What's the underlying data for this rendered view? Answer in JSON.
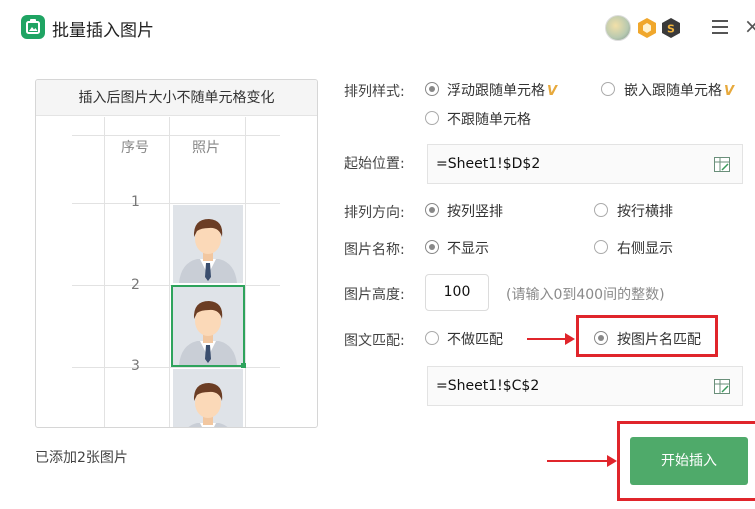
{
  "app": {
    "title": "批量插入图片",
    "accent_color": "#1fa463",
    "icons": [
      "app-icon",
      "avatar",
      "vip-badge-icon",
      "s-badge-icon",
      "menu-icon",
      "close-icon"
    ]
  },
  "preview": {
    "header": "插入后图片大小不随单元格变化",
    "col_headers": [
      "序号",
      "照片"
    ],
    "rows": [
      "1",
      "2",
      "3"
    ]
  },
  "status": {
    "added": "已添加2张图片"
  },
  "form": {
    "layout_label": "排列样式:",
    "layout_options": [
      "浮动跟随单元格",
      "嵌入跟随单元格",
      "不跟随单元格"
    ],
    "layout_vip_mark": "V",
    "start_label": "起始位置:",
    "start_value": "=Sheet1!$D$2",
    "direction_label": "排列方向:",
    "direction_options": [
      "按列竖排",
      "按行横排"
    ],
    "name_label": "图片名称:",
    "name_options": [
      "不显示",
      "右侧显示"
    ],
    "height_label": "图片高度:",
    "height_value": "100",
    "height_hint": "(请输入0到400间的整数)",
    "match_label": "图文匹配:",
    "match_options": [
      "不做匹配",
      "按图片名匹配"
    ],
    "match_value": "=Sheet1!$C$2"
  },
  "actions": {
    "start_insert": "开始插入",
    "button_color": "#4faa6a",
    "highlight_color": "#e0252b"
  }
}
